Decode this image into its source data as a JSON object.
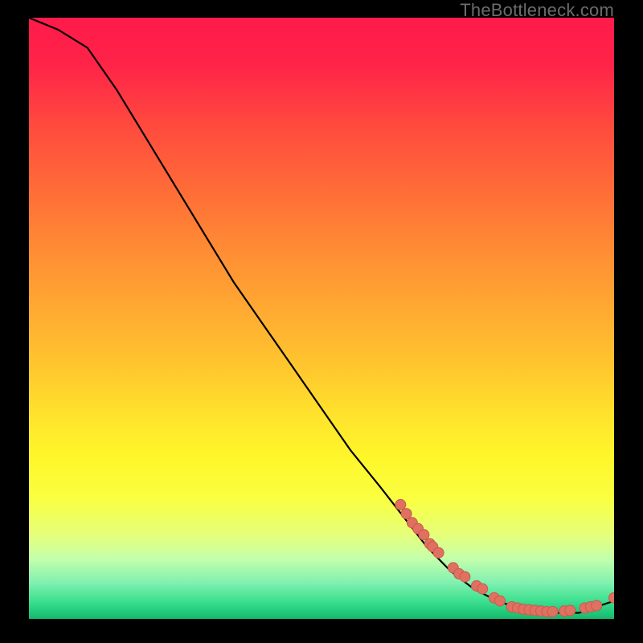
{
  "watermark": {
    "text": "TheBottleneck.com"
  },
  "colors": {
    "page_bg": "#000000",
    "curve": "#000000",
    "marker_fill": "#e07060",
    "marker_stroke": "#c85a50"
  },
  "chart_data": {
    "type": "line",
    "title": "",
    "xlabel": "",
    "ylabel": "",
    "xlim": [
      0,
      100
    ],
    "ylim": [
      0,
      100
    ],
    "grid": false,
    "legend": false,
    "series": [
      {
        "name": "curve",
        "x": [
          0,
          5,
          10,
          15,
          20,
          25,
          30,
          35,
          40,
          45,
          50,
          55,
          60,
          64,
          68,
          72,
          76,
          80,
          83,
          86,
          88,
          91,
          94,
          97,
          100
        ],
        "y": [
          100,
          98,
          95,
          88,
          80,
          72,
          64,
          56,
          49,
          42,
          35,
          28,
          22,
          17,
          12,
          8,
          5,
          3,
          2,
          1,
          1,
          1,
          1,
          2,
          3
        ]
      }
    ],
    "markers": [
      {
        "x": 63.5,
        "y": 19.0
      },
      {
        "x": 64.5,
        "y": 17.5
      },
      {
        "x": 65.5,
        "y": 16.0
      },
      {
        "x": 66.5,
        "y": 15.0
      },
      {
        "x": 67.5,
        "y": 14.0
      },
      {
        "x": 68.5,
        "y": 12.5
      },
      {
        "x": 69.0,
        "y": 12.0
      },
      {
        "x": 70.0,
        "y": 11.0
      },
      {
        "x": 72.5,
        "y": 8.5
      },
      {
        "x": 73.5,
        "y": 7.5
      },
      {
        "x": 74.5,
        "y": 7.0
      },
      {
        "x": 76.5,
        "y": 5.5
      },
      {
        "x": 77.5,
        "y": 5.0
      },
      {
        "x": 79.5,
        "y": 3.5
      },
      {
        "x": 80.5,
        "y": 3.0
      },
      {
        "x": 82.5,
        "y": 2.0
      },
      {
        "x": 83.5,
        "y": 1.8
      },
      {
        "x": 84.5,
        "y": 1.6
      },
      {
        "x": 85.5,
        "y": 1.5
      },
      {
        "x": 86.5,
        "y": 1.4
      },
      {
        "x": 87.5,
        "y": 1.3
      },
      {
        "x": 88.5,
        "y": 1.2
      },
      {
        "x": 89.5,
        "y": 1.2
      },
      {
        "x": 91.5,
        "y": 1.3
      },
      {
        "x": 92.5,
        "y": 1.4
      },
      {
        "x": 95.0,
        "y": 1.8
      },
      {
        "x": 96.0,
        "y": 2.0
      },
      {
        "x": 97.0,
        "y": 2.2
      },
      {
        "x": 100.0,
        "y": 3.5
      }
    ]
  }
}
